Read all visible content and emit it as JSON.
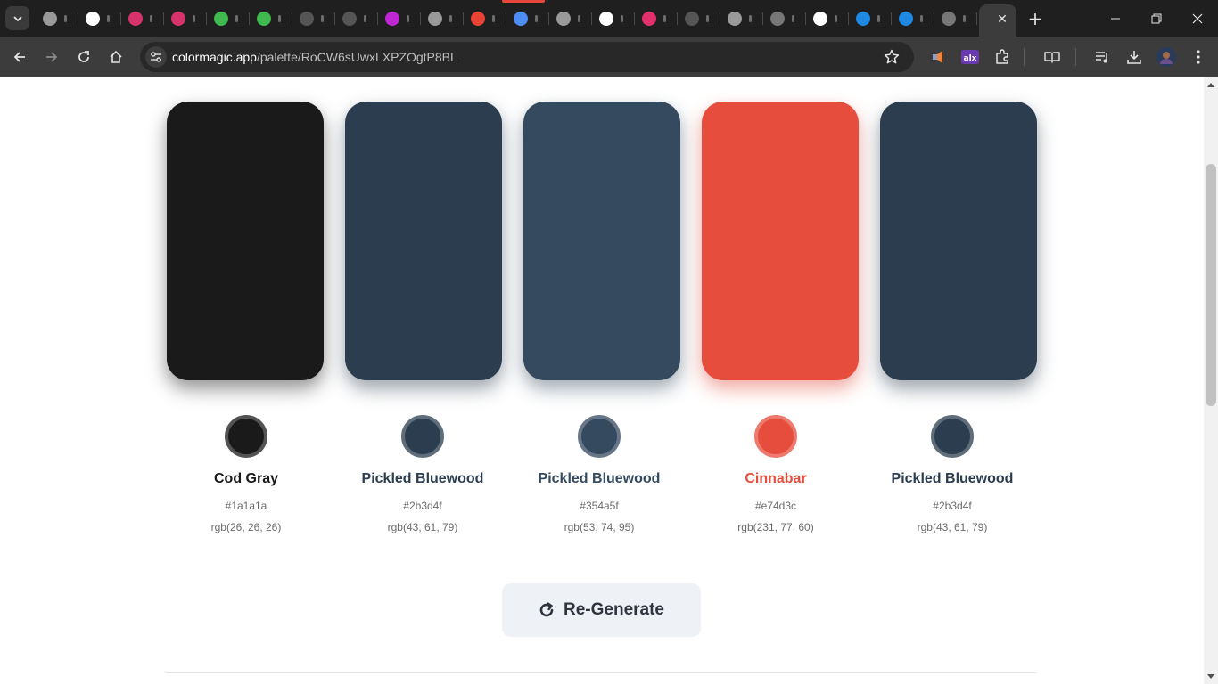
{
  "browser": {
    "url_host": "colormagic.app",
    "url_path": "/palette/RoCW6sUwxLXPZOgtP8BL",
    "tabs": [
      {
        "icon": "globe-icon",
        "color": "#9a9a9a"
      },
      {
        "icon": "chatgpt-icon",
        "color": "#ffffff"
      },
      {
        "icon": "app-icon",
        "color": "#d6336c"
      },
      {
        "icon": "app-icon",
        "color": "#d6336c"
      },
      {
        "icon": "github-icon",
        "color": "#3fb950"
      },
      {
        "icon": "github-icon",
        "color": "#3fb950"
      },
      {
        "icon": "blank-icon",
        "color": "#555555"
      },
      {
        "icon": "blank-icon",
        "color": "#555555"
      },
      {
        "icon": "ring-icon",
        "color": "#c026d3"
      },
      {
        "icon": "globe-icon",
        "color": "#9a9a9a"
      },
      {
        "icon": "gmail-icon",
        "color": "#ea4335"
      },
      {
        "icon": "gemini-icon",
        "color": "#4c8df6"
      },
      {
        "icon": "globe-icon",
        "color": "#9a9a9a"
      },
      {
        "icon": "app-icon",
        "color": "#ffffff"
      },
      {
        "icon": "instagram-icon",
        "color": "#e1306c"
      },
      {
        "icon": "blank-icon",
        "color": "#555555"
      },
      {
        "icon": "globe-icon",
        "color": "#9a9a9a"
      },
      {
        "icon": "avatar-icon",
        "color": "#777777"
      },
      {
        "icon": "github-icon",
        "color": "#ffffff"
      },
      {
        "icon": "app-icon",
        "color": "#1e88e5"
      },
      {
        "icon": "app-icon",
        "color": "#1e88e5"
      },
      {
        "icon": "avatar-icon",
        "color": "#777777"
      }
    ]
  },
  "palette": {
    "colors": [
      {
        "name": "Cod Gray",
        "hex": "#1a1a1a",
        "rgb": "rgb(26, 26, 26)",
        "text_color": "#1a1a1a"
      },
      {
        "name": "Pickled Bluewood",
        "hex": "#2b3d4f",
        "rgb": "rgb(43, 61, 79)",
        "text_color": "#2b3d4f"
      },
      {
        "name": "Pickled Bluewood",
        "hex": "#354a5f",
        "rgb": "rgb(53, 74, 95)",
        "text_color": "#354a5f"
      },
      {
        "name": "Cinnabar",
        "hex": "#e74d3c",
        "rgb": "rgb(231, 77, 60)",
        "text_color": "#e74d3c"
      },
      {
        "name": "Pickled Bluewood",
        "hex": "#2b3d4f",
        "rgb": "rgb(43, 61, 79)",
        "text_color": "#2b3d4f"
      }
    ],
    "regenerate_label": "Re-Generate"
  }
}
